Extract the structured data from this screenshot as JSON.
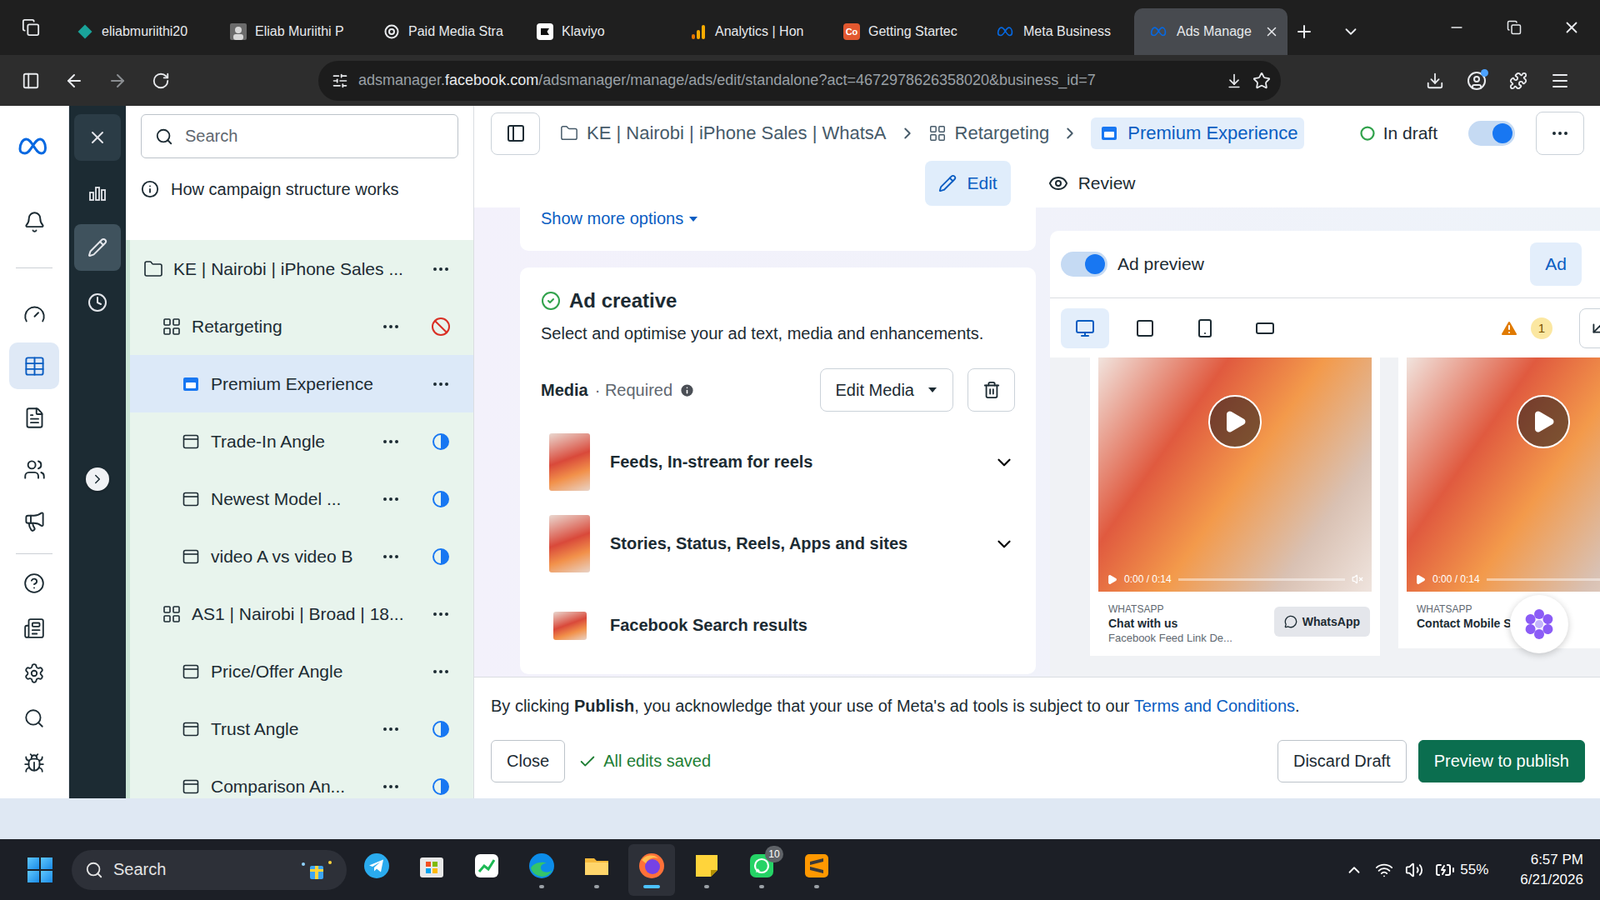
{
  "browser": {
    "tabs": [
      {
        "label": "eliabmuriithi20",
        "kind": "diamond",
        "selected": false
      },
      {
        "label": "Eliab Muriithi P",
        "kind": "avatar",
        "selected": false
      },
      {
        "label": "Paid Media Stra",
        "kind": "openai",
        "selected": false
      },
      {
        "label": "Klaviyo",
        "kind": "klaviyo",
        "selected": false
      },
      {
        "label": "Analytics | Hon",
        "kind": "analytics",
        "selected": false
      },
      {
        "label": "Getting Startec",
        "kind": "letters",
        "icon_text": "Co",
        "selected": false
      },
      {
        "label": "Meta Business",
        "kind": "meta",
        "selected": false
      },
      {
        "label": "Ads Manage",
        "kind": "meta",
        "selected": true
      }
    ],
    "address": {
      "prefix": "adsmanager.",
      "domain": "facebook.com",
      "path": "/adsmanager/manage/ads/edit/standalone?act=4672978626358020&business_id=7"
    }
  },
  "rail": {
    "header": [
      {
        "kind": "bell",
        "selected": false
      }
    ],
    "primary": [
      {
        "kind": "dashboard",
        "selected": false
      },
      {
        "kind": "table",
        "selected": true
      },
      {
        "kind": "documents",
        "selected": false
      },
      {
        "kind": "audience",
        "selected": false
      },
      {
        "kind": "campaigns",
        "selected": false
      }
    ],
    "secondary": [
      {
        "kind": "help",
        "selected": false
      },
      {
        "kind": "news",
        "selected": false
      },
      {
        "kind": "settings",
        "selected": false
      },
      {
        "kind": "search",
        "selected": false
      },
      {
        "kind": "bug",
        "selected": false
      }
    ]
  },
  "tools": [
    {
      "kind": "close",
      "selected": false
    },
    {
      "kind": "chart",
      "selected": false
    },
    {
      "kind": "edit",
      "selected": true
    },
    {
      "kind": "history",
      "selected": false
    }
  ],
  "tree": {
    "search_placeholder": "Search",
    "help": "How campaign structure works",
    "items": [
      {
        "name": "KE | Nairobi | iPhone Sales ...",
        "kind": "campaign",
        "status": "none",
        "selected": false
      },
      {
        "name": "Retargeting",
        "kind": "adset",
        "status": "off",
        "selected": false
      },
      {
        "name": "Premium Experience",
        "kind": "ad",
        "status": "none",
        "selected": true
      },
      {
        "name": "Trade-In Angle",
        "kind": "ad",
        "status": "partial",
        "selected": false
      },
      {
        "name": "Newest Model ...",
        "kind": "ad",
        "status": "partial",
        "selected": false
      },
      {
        "name": "video A vs video B",
        "kind": "ad",
        "status": "partial",
        "selected": false
      },
      {
        "name": "AS1 | Nairobi | Broad | 18...",
        "kind": "adset",
        "status": "none",
        "selected": false
      },
      {
        "name": "Price/Offer Angle",
        "kind": "ad",
        "status": "none",
        "selected": false
      },
      {
        "name": "Trust Angle",
        "kind": "ad",
        "status": "partial",
        "selected": false
      },
      {
        "name": "Comparison An...",
        "kind": "ad",
        "status": "partial",
        "selected": false
      }
    ]
  },
  "breadcrumbs": [
    {
      "label": "KE | Nairobi | iPhone Sales | WhatsA",
      "kind": "campaign",
      "selected": false
    },
    {
      "label": "Retargeting",
      "kind": "adset",
      "selected": false
    },
    {
      "label": "Premium Experience",
      "kind": "ad",
      "selected": true
    }
  ],
  "status": {
    "label": "In draft",
    "toggle_on": true
  },
  "mode_tabs": [
    {
      "label": "Edit",
      "kind": "edit",
      "selected": true
    },
    {
      "label": "Review",
      "kind": "review",
      "selected": false
    }
  ],
  "settings_card": {
    "link": "Show more options"
  },
  "creative": {
    "title": "Ad creative",
    "complete": true,
    "subtitle": "Select and optimise your ad text, media and enhancements.",
    "media": {
      "label": "Media",
      "separator": "·",
      "required": "Required",
      "button": "Edit Media"
    },
    "placements": [
      {
        "label": "Feeds, In-stream for reels",
        "kind": "vertical",
        "expandable": true
      },
      {
        "label": "Stories, Status, Reels, Apps and sites",
        "kind": "vertical",
        "expandable": true
      },
      {
        "label": "Facebook Search results",
        "kind": "wide",
        "expandable": false
      }
    ]
  },
  "preview": {
    "enabled": true,
    "title": "Ad preview",
    "button": "Ad",
    "devices": [
      {
        "kind": "desktop",
        "selected": true
      },
      {
        "kind": "square",
        "selected": false
      },
      {
        "kind": "mobile",
        "selected": false
      },
      {
        "kind": "landscape",
        "selected": false
      }
    ],
    "warnings": "1",
    "cards": [
      {
        "kicker": "WHATSAPP",
        "title": "Chat with us",
        "caption": "Facebook Feed Link De...",
        "cta_label": "WhatsApp",
        "time": "0:00 / 0:14",
        "muted": true,
        "progress": 0.0
      },
      {
        "kicker": "WHATSAPP",
        "title": "Contact Mobile Store CBD",
        "caption": "",
        "cta_label": "",
        "time": "0:00 / 0:14",
        "muted": true,
        "progress": 0.0
      }
    ]
  },
  "footer": {
    "terms_before": "By clicking ",
    "terms_bold": "Publish",
    "terms_after": ", you acknowledge that your use of Meta's ad tools is subject to our ",
    "terms_link": "Terms and Conditions",
    "terms_end": ".",
    "close": "Close",
    "saved": "All edits saved",
    "discard": "Discard Draft",
    "publish": "Preview to publish"
  },
  "taskbar": {
    "search": "Search",
    "apps": [
      {
        "kind": "telegram",
        "running": false,
        "active": false
      },
      {
        "kind": "store",
        "running": false,
        "active": false
      },
      {
        "kind": "chart",
        "running": false,
        "active": false
      },
      {
        "kind": "edge",
        "running": true,
        "active": false
      },
      {
        "kind": "explorer",
        "running": true,
        "active": false
      },
      {
        "kind": "firefox",
        "running": true,
        "active": true
      },
      {
        "kind": "sticky",
        "running": true,
        "active": false
      },
      {
        "kind": "whatsapp",
        "running": true,
        "active": false,
        "badge": "10"
      },
      {
        "kind": "sublime",
        "running": true,
        "active": false
      }
    ],
    "battery": "55%",
    "time": "6:57 PM",
    "date": "6/21/2026"
  }
}
